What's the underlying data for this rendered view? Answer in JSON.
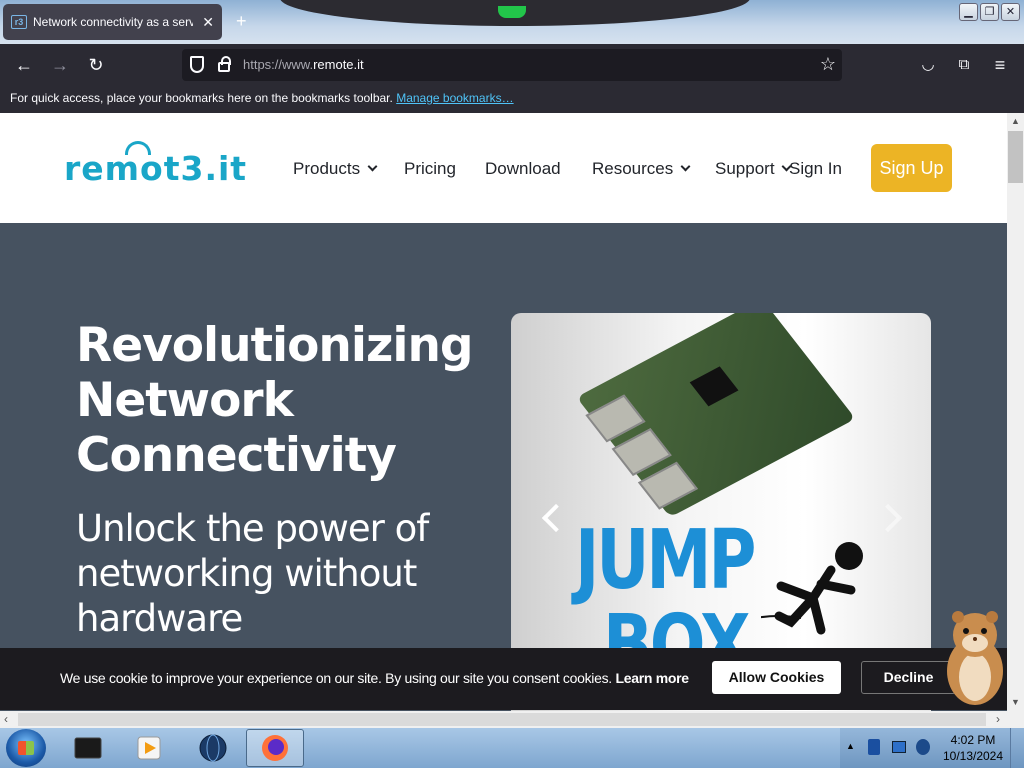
{
  "browser": {
    "tab_title": "Network connectivity as a servi",
    "tab_favicon": "r3",
    "url_prefix": "https://www.",
    "url_domain": "remote.it",
    "bookmarks_hint": "For quick access, place your bookmarks here on the bookmarks toolbar.",
    "manage_bookmarks": "Manage bookmarks…"
  },
  "site": {
    "logo_text": "remot3.it",
    "nav": {
      "products": "Products",
      "pricing": "Pricing",
      "download": "Download",
      "resources": "Resources",
      "support": "Support",
      "sign_in": "Sign In",
      "sign_up": "Sign Up"
    },
    "hero": {
      "title": "Revolutionizing Network Connectivity",
      "subtitle": "Unlock the power of networking without hardware"
    },
    "slide": {
      "text_line1": "JUMP",
      "text_line2": "BOX"
    },
    "cookie": {
      "message": "We use cookie to improve your experience on our site. By using our site you consent cookies.",
      "learn_more": "Learn more",
      "allow": "Allow Cookies",
      "decline": "Decline"
    }
  },
  "taskbar": {
    "time": "4:02 PM",
    "date": "10/13/2024"
  },
  "colors": {
    "brand": "#1aa6c8",
    "signup": "#ecb425",
    "hero_bg": "#465260",
    "browser_chrome": "#2b2a33"
  }
}
